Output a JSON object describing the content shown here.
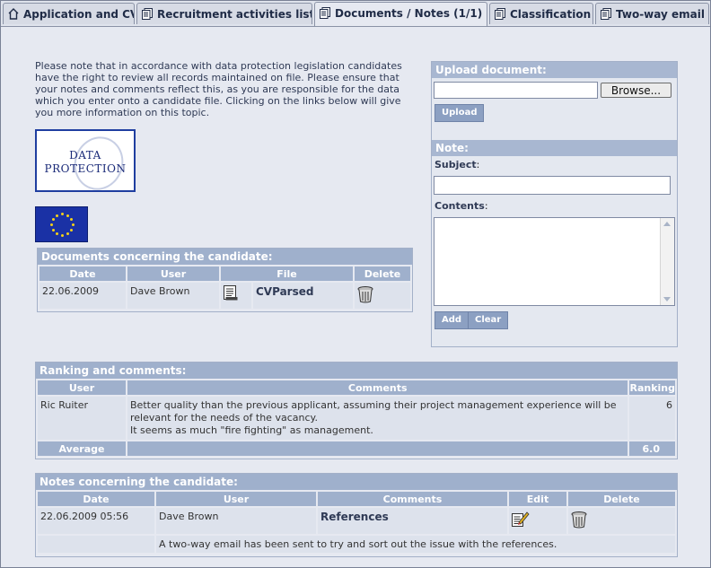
{
  "tabs": [
    {
      "label": "Application and CV",
      "icon": "home-icon"
    },
    {
      "label": "Recruitment activities list",
      "icon": "document-icon"
    },
    {
      "label": "Documents / Notes (1/1)",
      "icon": "document-icon"
    },
    {
      "label": "Classification",
      "icon": "document-icon"
    },
    {
      "label": "Two-way email",
      "icon": "document-icon"
    }
  ],
  "intro_text": "Please note that in accordance with data protection legislation candidates have the right to review all records maintained on file. Please ensure that your notes and comments reflect this, as you are responsible for the data which you enter onto a candidate file. Clicking on the links below will give you more information on this topic.",
  "logos": {
    "dp_line1": "Data",
    "dp_line2": "Protection"
  },
  "documents": {
    "title": "Documents concerning the candidate:",
    "columns": [
      "Date",
      "User",
      "File",
      "Delete"
    ],
    "rows": [
      {
        "date": "22.06.2009",
        "user": "Dave Brown",
        "file": "CVParsed"
      }
    ]
  },
  "upload": {
    "title": "Upload document:",
    "browse_label": "Browse...",
    "upload_label": "Upload"
  },
  "note": {
    "title": "Note:",
    "subject_label": "Subject",
    "contents_label": "Contents",
    "add_label": "Add",
    "clear_label": "Clear"
  },
  "ranking": {
    "title": "Ranking and comments:",
    "columns": [
      "User",
      "Comments",
      "Ranking"
    ],
    "rows": [
      {
        "user": "Ric Ruiter",
        "comment_line1": "Better quality than the previous applicant, assuming their project management experience will be relevant for the needs of the vacancy.",
        "comment_line2": "It seems as much \"fire fighting\" as management.",
        "ranking": "6"
      }
    ],
    "average_label": "Average",
    "average_value": "6.0"
  },
  "notes": {
    "title": "Notes concerning the candidate:",
    "columns": [
      "Date",
      "User",
      "Comments",
      "Edit",
      "Delete"
    ],
    "rows": [
      {
        "date": "22.06.2009 05:56",
        "user": "Dave Brown",
        "comment": "References",
        "detail": "A two-way email has been sent to try and sort out the issue with the references."
      }
    ]
  },
  "colors": {
    "header": "#9fb0cc",
    "background": "#e6e9f1",
    "cell": "#dde2ec",
    "button": "#8ca0c2"
  }
}
